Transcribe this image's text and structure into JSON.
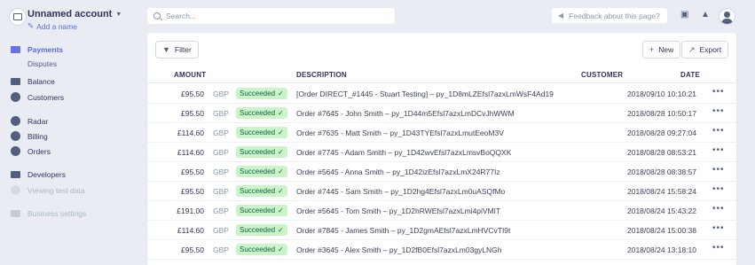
{
  "account": {
    "name": "Unnamed account",
    "add_name": "Add a name"
  },
  "sidebar": {
    "payments": "Payments",
    "disputes": "Disputes",
    "balance": "Balance",
    "customers": "Customers",
    "radar": "Radar",
    "billing": "Billing",
    "orders": "Orders",
    "developers": "Developers",
    "viewing_test_data": "Viewing test data",
    "business_settings": "Business settings"
  },
  "search": {
    "placeholder": "Search..."
  },
  "feedback": {
    "label": "Feedback about this page?"
  },
  "toolbar": {
    "filter": "Filter",
    "new": "New",
    "export": "Export"
  },
  "table": {
    "headers": {
      "amount": "AMOUNT",
      "description": "DESCRIPTION",
      "customer": "CUSTOMER",
      "date": "DATE"
    },
    "rows": [
      {
        "amount": "£95.50",
        "currency": "GBP",
        "status": "Succeeded",
        "description": "[Order DIRECT_#1445 - Stuart Testing] – py_1D8mLZEfsl7azxLmWsF4Ad19",
        "date": "2018/09/10 10:10:21"
      },
      {
        "amount": "£95.50",
        "currency": "GBP",
        "status": "Succeeded",
        "description": "Order #7645 - John Smith – py_1D44m5Efsl7azxLmDCvJhWWM",
        "date": "2018/08/28 10:50:17"
      },
      {
        "amount": "£114.60",
        "currency": "GBP",
        "status": "Succeeded",
        "description": "Order #7635 - Matt Smith – py_1D43TYEfsl7azxLmutEeoM3V",
        "date": "2018/08/28 09:27:04"
      },
      {
        "amount": "£114.60",
        "currency": "GBP",
        "status": "Succeeded",
        "description": "Order #7745 - Adam Smith – py_1D42wvEfsl7azxLmsvBoQQXK",
        "date": "2018/08/28 08:53:21"
      },
      {
        "amount": "£95.50",
        "currency": "GBP",
        "status": "Succeeded",
        "description": "Order #5645 - Anna Smith – py_1D42izEfsl7azxLmX24R77Iz",
        "date": "2018/08/28 08:38:57"
      },
      {
        "amount": "£95.50",
        "currency": "GBP",
        "status": "Succeeded",
        "description": "Order #7445 - Sam Smith – py_1D2hg4Efsl7azxLm0uASQfMo",
        "date": "2018/08/24 15:58:24"
      },
      {
        "amount": "£191.00",
        "currency": "GBP",
        "status": "Succeeded",
        "description": "Order #5645 - Tom Smith – py_1D2hRWEfsl7azxLmi4piVMIT",
        "date": "2018/08/24 15:43:22"
      },
      {
        "amount": "£114.60",
        "currency": "GBP",
        "status": "Succeeded",
        "description": "Order #7845 - James Smith – py_1D2gmAEfsl7azxLmHVCvTI9t",
        "date": "2018/08/24 15:00:38"
      },
      {
        "amount": "£95.50",
        "currency": "GBP",
        "status": "Succeeded",
        "description": "Order #3645 - Alex Smith – py_1D2fB0Efsl7azxLm03gyLNGh",
        "date": "2018/08/24 13:18:10"
      }
    ]
  },
  "colors": {
    "accent": "#556cd6",
    "success_bg": "#cbf4c9",
    "success_text": "#0e6245",
    "background": "#e9edf3"
  }
}
